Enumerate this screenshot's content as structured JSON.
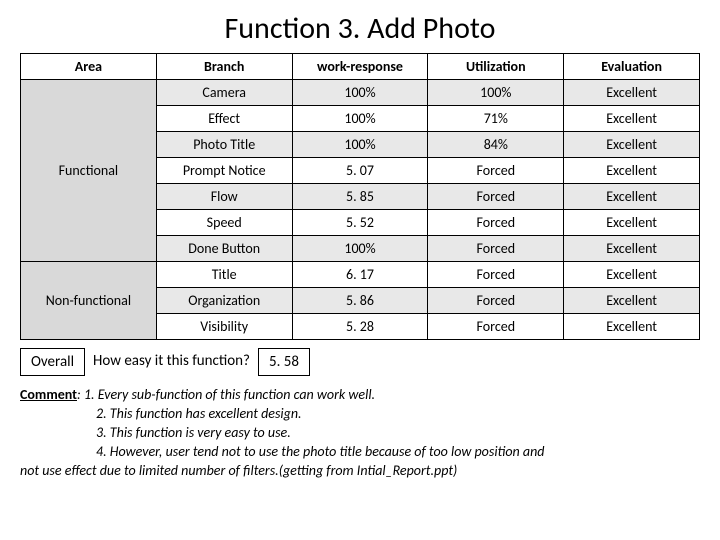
{
  "title": "Function 3. Add Photo",
  "headers": {
    "area": "Area",
    "branch": "Branch",
    "work_response": "work-response",
    "utilization": "Utilization",
    "evaluation": "Evaluation"
  },
  "groups": [
    {
      "area": "Functional",
      "rows": [
        {
          "branch": "Camera",
          "work_response": "100%",
          "utilization": "100%",
          "evaluation": "Excellent"
        },
        {
          "branch": "Effect",
          "work_response": "100%",
          "utilization": "71%",
          "evaluation": "Excellent"
        },
        {
          "branch": "Photo Title",
          "work_response": "100%",
          "utilization": "84%",
          "evaluation": "Excellent"
        },
        {
          "branch": "Prompt Notice",
          "work_response": "5. 07",
          "utilization": "Forced",
          "evaluation": "Excellent"
        },
        {
          "branch": "Flow",
          "work_response": "5. 85",
          "utilization": "Forced",
          "evaluation": "Excellent"
        },
        {
          "branch": "Speed",
          "work_response": "5. 52",
          "utilization": "Forced",
          "evaluation": "Excellent"
        },
        {
          "branch": "Done Button",
          "work_response": "100%",
          "utilization": "Forced",
          "evaluation": "Excellent"
        }
      ]
    },
    {
      "area": "Non-functional",
      "rows": [
        {
          "branch": "Title",
          "work_response": "6. 17",
          "utilization": "Forced",
          "evaluation": "Excellent"
        },
        {
          "branch": "Organization",
          "work_response": "5. 86",
          "utilization": "Forced",
          "evaluation": "Excellent"
        },
        {
          "branch": "Visibility",
          "work_response": "5. 28",
          "utilization": "Forced",
          "evaluation": "Excellent"
        }
      ]
    }
  ],
  "overall": {
    "label": "Overall",
    "question": "How easy it this function?",
    "value": "5. 58"
  },
  "comment": {
    "label": "Comment",
    "lines": [
      "1. Every sub-function of this function can work well.",
      "2. This function has excellent design.",
      "3. This function is very easy to use.",
      "4. However, user tend not to use the photo title because of too low position and not use effect due to limited number of filters.(getting from Intial_Report.ppt)"
    ]
  },
  "chart_data": {
    "type": "table",
    "title": "Function 3. Add Photo",
    "columns": [
      "Area",
      "Branch",
      "work-response",
      "Utilization",
      "Evaluation"
    ],
    "rows": [
      [
        "Functional",
        "Camera",
        "100%",
        "100%",
        "Excellent"
      ],
      [
        "Functional",
        "Effect",
        "100%",
        "71%",
        "Excellent"
      ],
      [
        "Functional",
        "Photo Title",
        "100%",
        "84%",
        "Excellent"
      ],
      [
        "Functional",
        "Prompt Notice",
        "5. 07",
        "Forced",
        "Excellent"
      ],
      [
        "Functional",
        "Flow",
        "5. 85",
        "Forced",
        "Excellent"
      ],
      [
        "Functional",
        "Speed",
        "5. 52",
        "Forced",
        "Excellent"
      ],
      [
        "Functional",
        "Done Button",
        "100%",
        "Forced",
        "Excellent"
      ],
      [
        "Non-functional",
        "Title",
        "6. 17",
        "Forced",
        "Excellent"
      ],
      [
        "Non-functional",
        "Organization",
        "5. 86",
        "Forced",
        "Excellent"
      ],
      [
        "Non-functional",
        "Visibility",
        "5. 28",
        "Forced",
        "Excellent"
      ]
    ],
    "overall": {
      "question": "How easy it this function?",
      "value": "5. 58"
    }
  }
}
